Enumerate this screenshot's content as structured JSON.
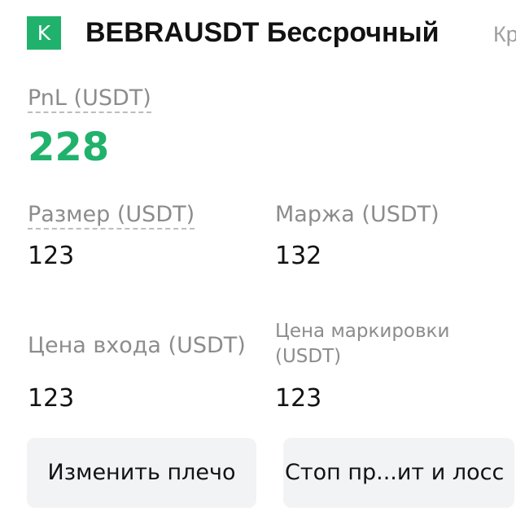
{
  "header": {
    "badge": "K",
    "title": "BEBRAUSDT Бессрочный",
    "tag": "Кр"
  },
  "pnl": {
    "label": "PnL (USDT)",
    "value": "228"
  },
  "size": {
    "label": "Размер (USDT)",
    "value": "123"
  },
  "margin": {
    "label": "Маржа (USDT)",
    "value": "132"
  },
  "entry_price": {
    "label": "Цена входа (USDT)",
    "value": "123"
  },
  "mark_price": {
    "label": "Цена маркировки (USDT)",
    "value": "123"
  },
  "actions": {
    "change_leverage": "Изменить плечо",
    "tp_sl": "Стоп пр...ит и лосс"
  },
  "colors": {
    "accent_green": "#20b26c",
    "label_gray": "#8c8c8c",
    "button_bg": "#f2f3f5"
  }
}
